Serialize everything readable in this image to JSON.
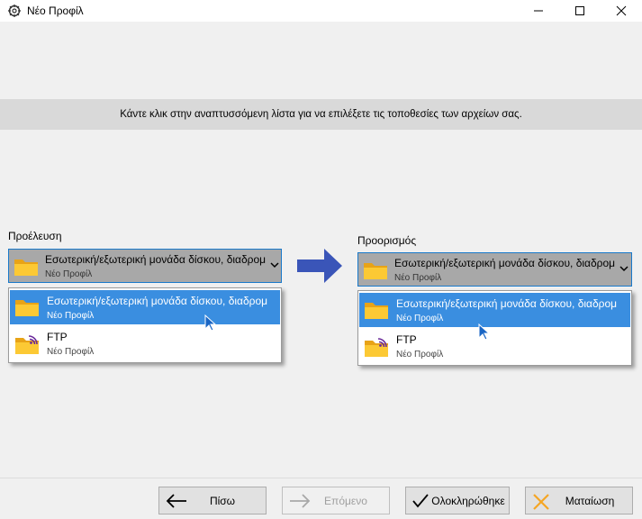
{
  "window": {
    "title": "Νέο Προφίλ",
    "icon": "app-gear-icon",
    "controls": [
      "minimize",
      "maximize",
      "close"
    ]
  },
  "instruction": "Κάντε κλικ στην αναπτυσσόμενη λίστα για να επιλέξετε τις τοποθεσίες των αρχείων σας.",
  "source": {
    "label": "Προέλευση",
    "selected": {
      "main": "Εσωτερική/εξωτερική μονάδα δίσκου, διαδρομ",
      "sub": "Νέο Προφίλ",
      "icon": "folder-icon"
    },
    "options": [
      {
        "main": "Εσωτερική/εξωτερική μονάδα δίσκου, διαδρομ",
        "sub": "Νέο Προφίλ",
        "icon": "folder-icon",
        "highlighted": true
      },
      {
        "main": "FTP",
        "sub": "Νέο Προφίλ",
        "icon": "ftp-folder-icon",
        "highlighted": false
      }
    ]
  },
  "destination": {
    "label": "Προορισμός",
    "selected": {
      "main": "Εσωτερική/εξωτερική μονάδα δίσκου, διαδρομ",
      "sub": "Νέο Προφίλ",
      "icon": "folder-icon"
    },
    "options": [
      {
        "main": "Εσωτερική/εξωτερική μονάδα δίσκου, διαδρομ",
        "sub": "Νέο Προφίλ",
        "icon": "folder-icon",
        "highlighted": true
      },
      {
        "main": "FTP",
        "sub": "Νέο Προφίλ",
        "icon": "ftp-folder-icon",
        "highlighted": false
      }
    ]
  },
  "buttons": {
    "back": {
      "label": "Πίσω",
      "icon": "arrow-left-icon",
      "enabled": true
    },
    "next": {
      "label": "Επόμενο",
      "icon": "arrow-right-icon",
      "enabled": false
    },
    "finish": {
      "label": "Ολοκληρώθηκε",
      "icon": "checkmark-icon",
      "enabled": true
    },
    "cancel": {
      "label": "Ματαίωση",
      "icon": "x-icon",
      "enabled": true
    }
  },
  "colors": {
    "highlight": "#3a8ee0",
    "combo_bg": "#a8a8a8",
    "arrow": "#3a55b8",
    "cancel_x": "#f5a623"
  }
}
